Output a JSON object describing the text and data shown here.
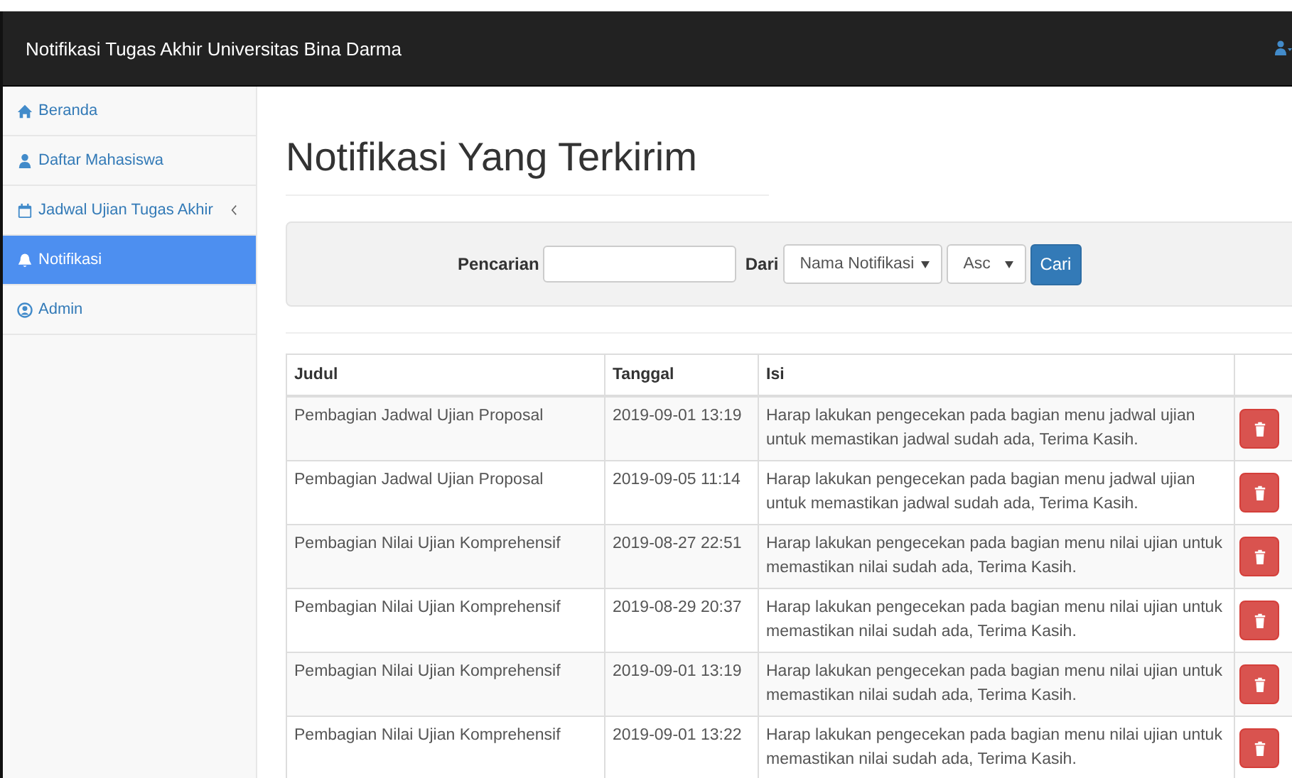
{
  "navbar": {
    "brand": "Notifikasi Tugas Akhir Universitas Bina Darma"
  },
  "sidebar": {
    "items": [
      {
        "label": "Beranda",
        "kind": "home",
        "selected": false,
        "has_submenu": false
      },
      {
        "label": "Daftar Mahasiswa",
        "kind": "user",
        "selected": false,
        "has_submenu": false
      },
      {
        "label": "Jadwal Ujian Tugas Akhir",
        "kind": "calendar",
        "selected": false,
        "has_submenu": true
      },
      {
        "label": "Notifikasi",
        "kind": "bell",
        "selected": true,
        "has_submenu": false
      },
      {
        "label": "Admin",
        "kind": "user-circle",
        "selected": false,
        "has_submenu": false
      }
    ]
  },
  "page": {
    "title": "Notifikasi Yang Terkirim"
  },
  "search": {
    "label": "Pencarian",
    "from_label": "Dari",
    "field_select": "Nama Notifikasi",
    "order_select": "Asc",
    "button": "Cari"
  },
  "table": {
    "columns": [
      "Judul",
      "Tanggal",
      "Isi"
    ],
    "rows": [
      {
        "judul": "Pembagian Jadwal Ujian Proposal",
        "tanggal": "2019-09-01 13:19",
        "isi": "Harap lakukan pengecekan pada bagian menu jadwal ujian untuk memastikan jadwal sudah ada, Terima Kasih."
      },
      {
        "judul": "Pembagian Jadwal Ujian Proposal",
        "tanggal": "2019-09-05 11:14",
        "isi": "Harap lakukan pengecekan pada bagian menu jadwal ujian untuk memastikan jadwal sudah ada, Terima Kasih."
      },
      {
        "judul": "Pembagian Nilai Ujian Komprehensif",
        "tanggal": "2019-08-27 22:51",
        "isi": "Harap lakukan pengecekan pada bagian menu nilai ujian untuk memastikan nilai sudah ada, Terima Kasih."
      },
      {
        "judul": "Pembagian Nilai Ujian Komprehensif",
        "tanggal": "2019-08-29 20:37",
        "isi": "Harap lakukan pengecekan pada bagian menu nilai ujian untuk memastikan nilai sudah ada, Terima Kasih."
      },
      {
        "judul": "Pembagian Nilai Ujian Komprehensif",
        "tanggal": "2019-09-01 13:19",
        "isi": "Harap lakukan pengecekan pada bagian menu nilai ujian untuk memastikan nilai sudah ada, Terima Kasih."
      },
      {
        "judul": "Pembagian Nilai Ujian Komprehensif",
        "tanggal": "2019-09-01 13:22",
        "isi": "Harap lakukan pengecekan pada bagian menu nilai ujian untuk memastikan nilai sudah ada, Terima Kasih."
      }
    ]
  }
}
